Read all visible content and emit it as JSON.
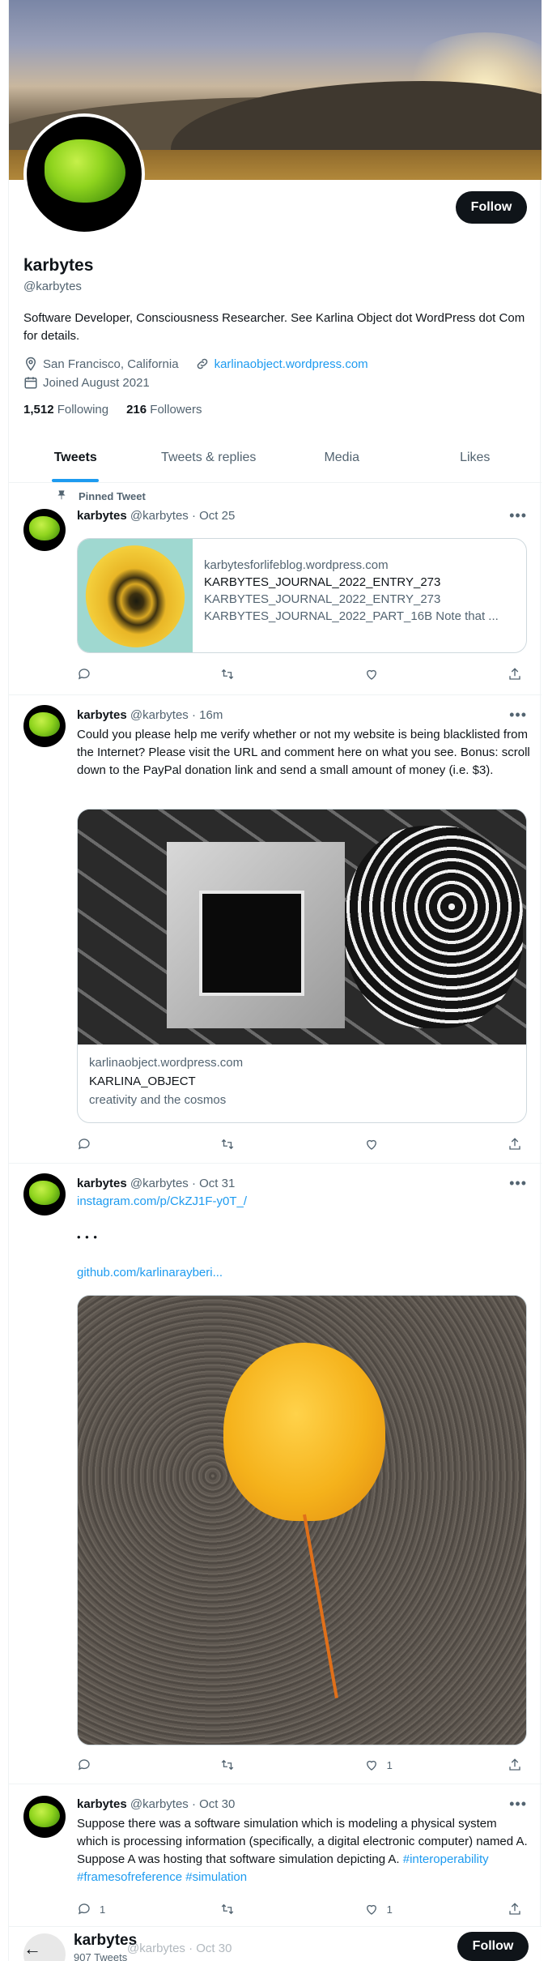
{
  "profile": {
    "name": "karbytes",
    "handle": "@karbytes",
    "bio": "Software Developer, Consciousness Researcher. See Karlina Object dot WordPress dot Com for details.",
    "location": "San Francisco, California",
    "website": "karlinaobject.wordpress.com",
    "joined": "Joined August 2021",
    "following_count": "1,512",
    "following_label": "Following",
    "followers_count": "216",
    "followers_label": "Followers",
    "follow_button": "Follow"
  },
  "tabs": [
    {
      "label": "Tweets",
      "active": true
    },
    {
      "label": "Tweets & replies",
      "active": false
    },
    {
      "label": "Media",
      "active": false
    },
    {
      "label": "Likes",
      "active": false
    }
  ],
  "tweets": [
    {
      "pinned_label": "Pinned Tweet",
      "name": "karbytes",
      "meta": "@karbytes · Oct 25",
      "card": {
        "domain": "karbytesforlifeblog.wordpress.com",
        "title": "KARBYTES_JOURNAL_2022_ENTRY_273",
        "desc1": "KARBYTES_JOURNAL_2022_ENTRY_273",
        "desc2": "KARBYTES_JOURNAL_2022_PART_16B Note that ..."
      },
      "counts": {
        "reply": "",
        "retweet": "",
        "like": ""
      }
    },
    {
      "name": "karbytes",
      "meta": "@karbytes · 16m",
      "text": "Could you please help me verify whether or not my website is being blacklisted from the Internet? Please visit the URL and comment here on what you see. Bonus: scroll down to the PayPal donation link and send a small amount of money (i.e. $3).",
      "card": {
        "domain": "karlinaobject.wordpress.com",
        "title": "KARLINA_OBJECT",
        "desc1": "creativity and the cosmos"
      },
      "counts": {
        "reply": "",
        "retweet": "",
        "like": ""
      }
    },
    {
      "name": "karbytes",
      "meta": "@karbytes · Oct 31",
      "link1": "instagram.com/p/CkZJ1F-y0T_/",
      "ellipsis": "• • •",
      "link2": "github.com/karlinarayberi...",
      "counts": {
        "reply": "",
        "retweet": "",
        "like": "1"
      }
    },
    {
      "name": "karbytes",
      "meta": "@karbytes · Oct 30",
      "text": "Suppose there was a software simulation which is modeling a physical system which is processing information (specifically, a digital electronic computer) named A. Suppose A was hosting that software simulation depicting A.",
      "hashtags": "#interoperability #framesofreference #simulation",
      "counts": {
        "reply": "1",
        "retweet": "",
        "like": "1"
      }
    }
  ],
  "sticky_header": {
    "name": "karbytes",
    "subtitle": "907 Tweets",
    "overlap_meta": "@karbytes · Oct 30",
    "follow_button": "Follow"
  },
  "colors": {
    "accent": "#1d9bf0",
    "text": "#0f1419",
    "muted": "#536471",
    "border": "#cfd9de"
  }
}
